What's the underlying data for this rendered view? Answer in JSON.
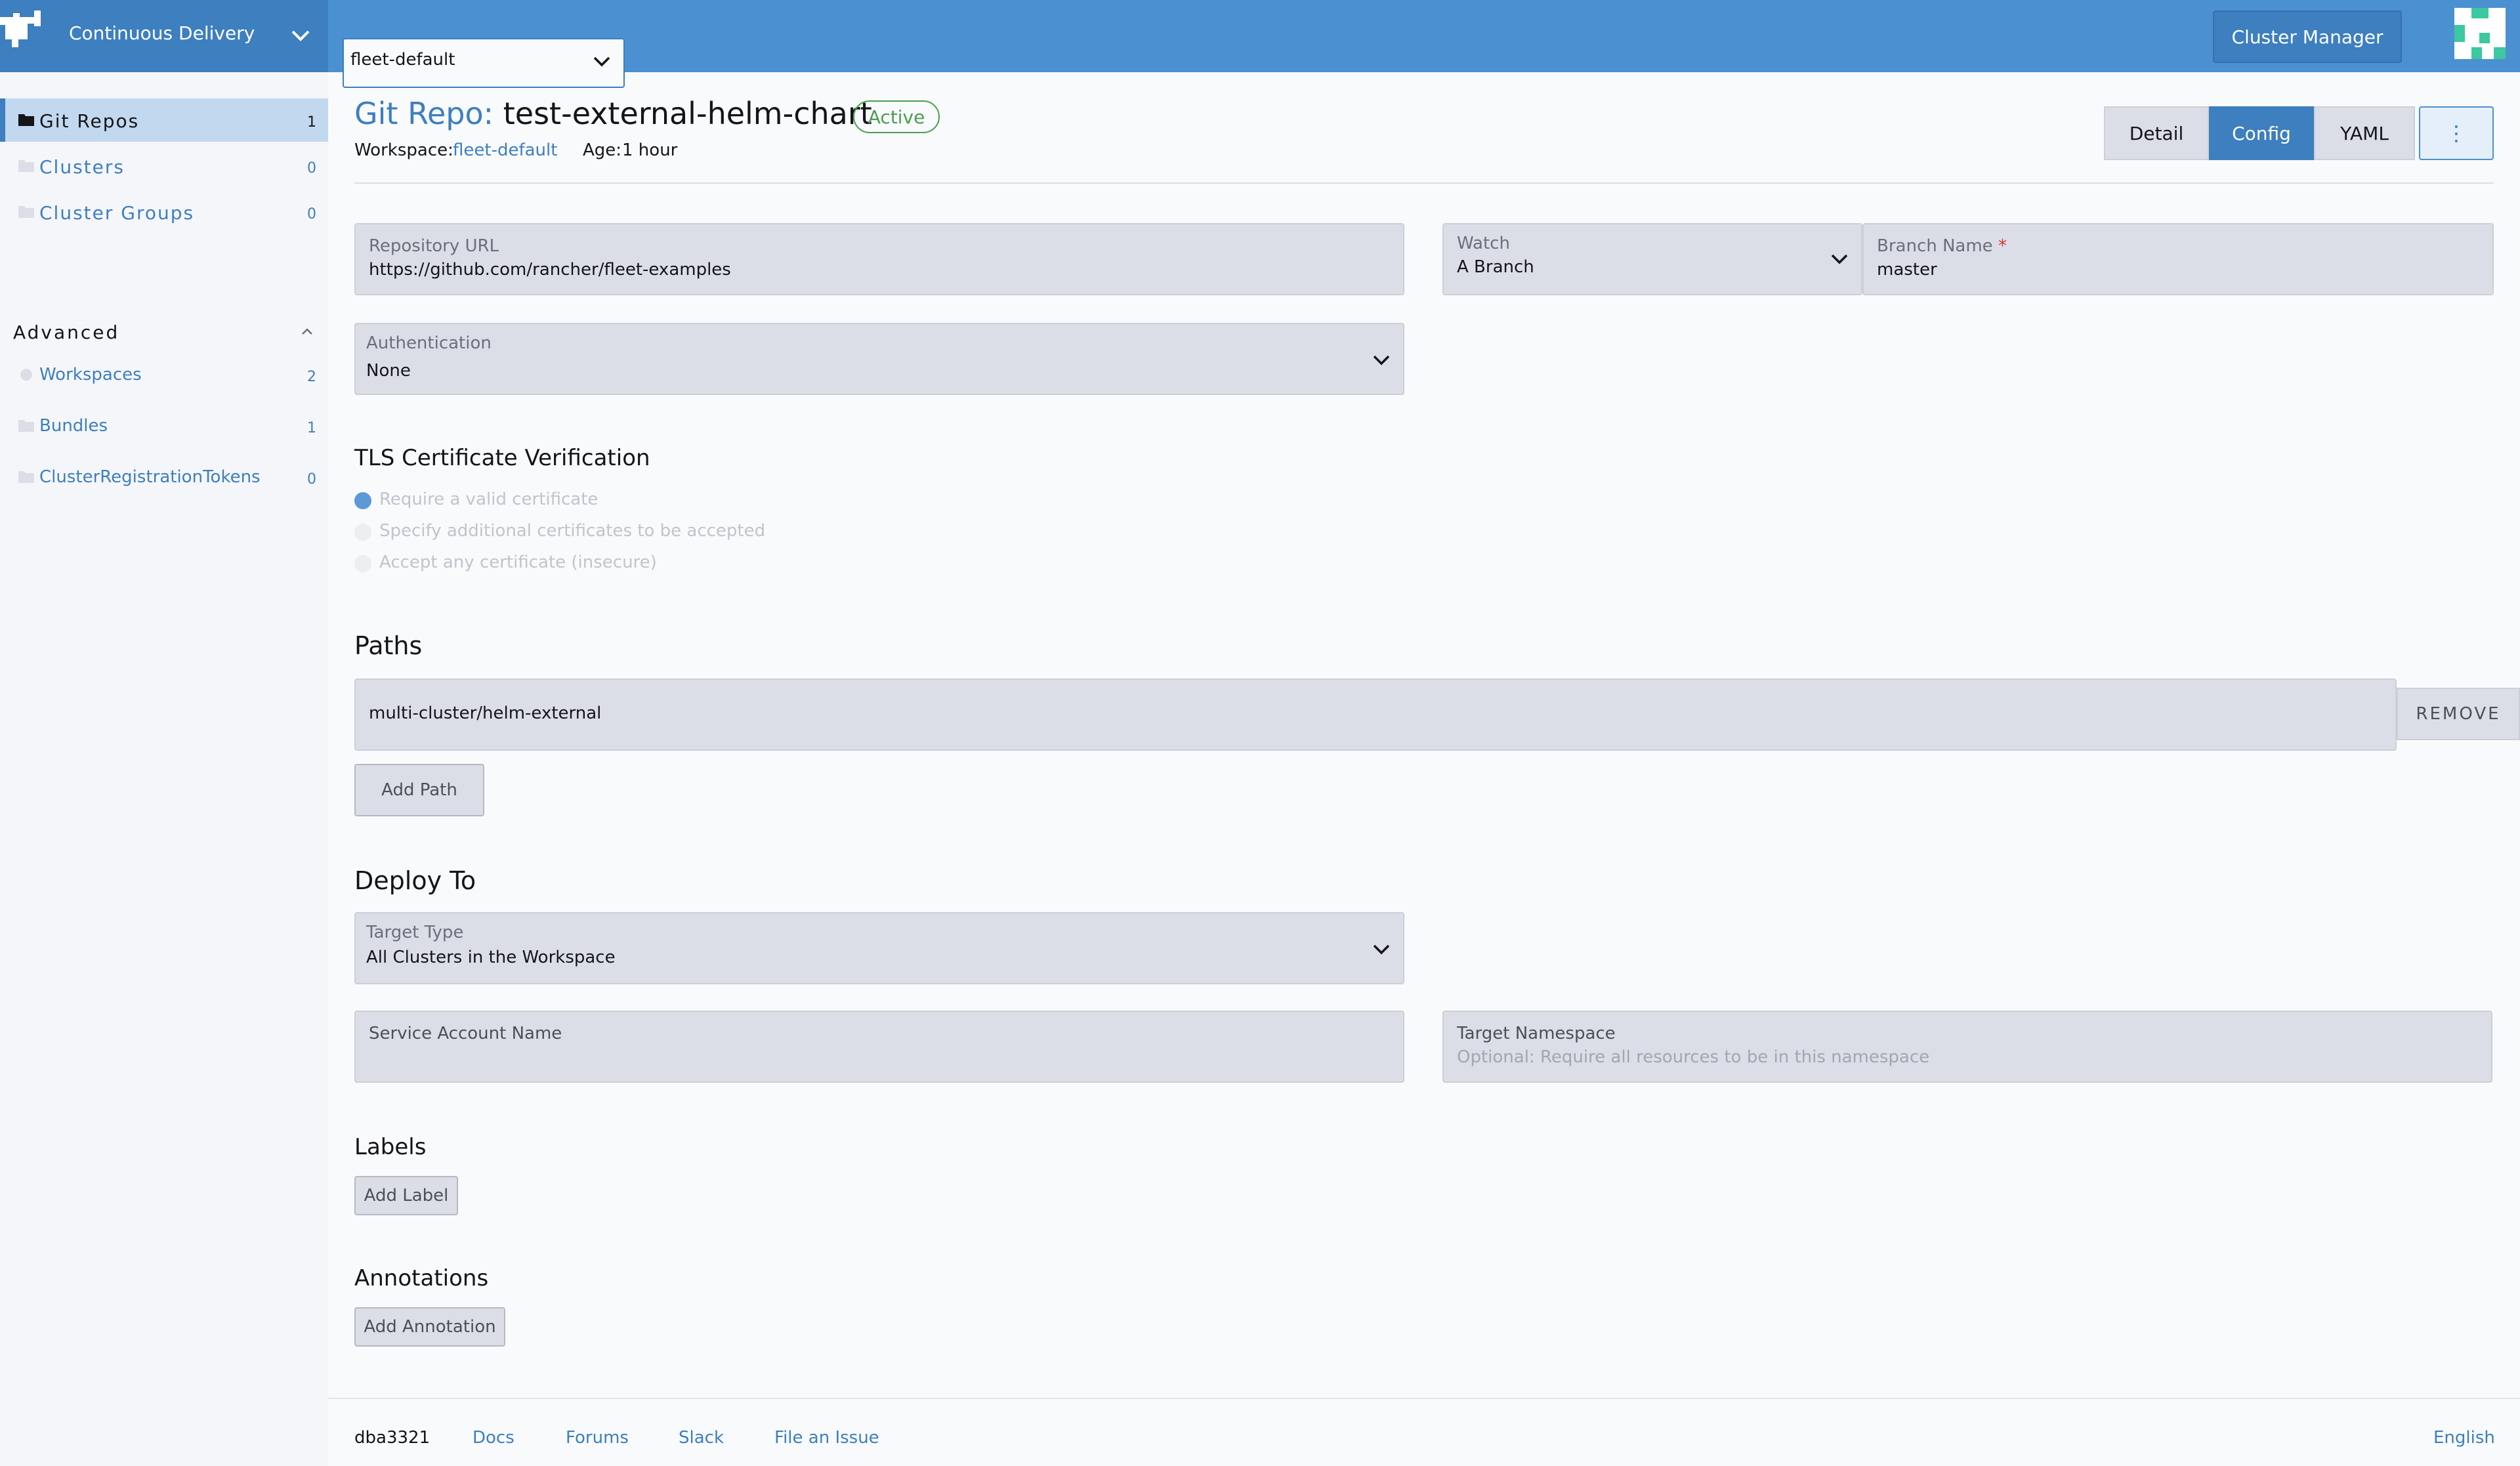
{
  "header": {
    "product": "Continuous Delivery",
    "workspace_select": "fleet-default",
    "cluster_manager": "Cluster Manager"
  },
  "sidebar": {
    "items": [
      {
        "label": "Git Repos",
        "count": "1"
      },
      {
        "label": "Clusters",
        "count": "0"
      },
      {
        "label": "Cluster Groups",
        "count": "0"
      }
    ],
    "group": "Advanced",
    "advanced_items": [
      {
        "label": "Workspaces",
        "count": "2"
      },
      {
        "label": "Bundles",
        "count": "1"
      },
      {
        "label": "ClusterRegistrationTokens",
        "count": "0"
      }
    ]
  },
  "page": {
    "kind": "Git Repo:",
    "name": "test-external-helm-chart",
    "status": "Active",
    "workspace_label": "Workspace:",
    "workspace_value": "fleet-default",
    "age_label": "Age:",
    "age_value": "1 hour",
    "tabs": [
      "Detail",
      "Config",
      "YAML"
    ],
    "more": "⋮"
  },
  "form": {
    "repo_url": {
      "label": "Repository URL",
      "value": "https://github.com/rancher/fleet-examples"
    },
    "watch": {
      "label": "Watch",
      "value": "A Branch"
    },
    "branch": {
      "label": "Branch Name",
      "required": "*",
      "value": "master"
    },
    "auth": {
      "label": "Authentication",
      "value": "None"
    },
    "tls": {
      "title": "TLS Certificate Verification",
      "options": [
        "Require a valid certificate",
        "Specify additional certificates to be accepted",
        "Accept any certificate (insecure)"
      ]
    },
    "paths": {
      "title": "Paths",
      "value": "multi-cluster/helm-external",
      "remove": "REMOVE",
      "add": "Add Path"
    },
    "deploy": {
      "title": "Deploy To",
      "target_type_label": "Target Type",
      "target_type_value": "All Clusters in the Workspace",
      "service_account_label": "Service Account Name",
      "target_ns_label": "Target Namespace",
      "target_ns_placeholder": "Optional: Require all resources to be in this namespace"
    },
    "labels": {
      "title": "Labels",
      "add": "Add Label"
    },
    "annotations": {
      "title": "Annotations",
      "add": "Add Annotation"
    }
  },
  "footer": {
    "version": "dba3321",
    "links": [
      "Docs",
      "Forums",
      "Slack",
      "File an Issue"
    ],
    "language": "English"
  }
}
